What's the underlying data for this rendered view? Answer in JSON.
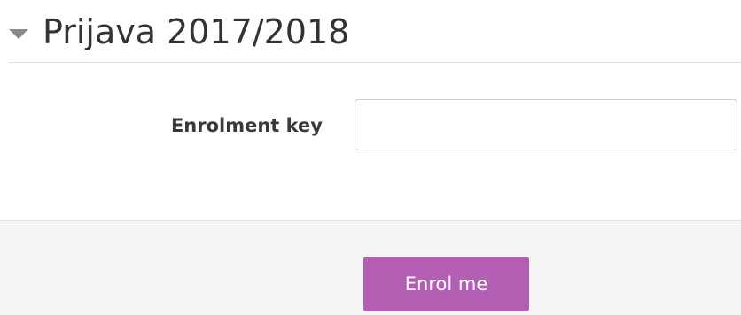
{
  "section": {
    "title": "Prijava 2017/2018",
    "collapse_icon": "caret-down-icon"
  },
  "form": {
    "enrolment_key_label": "Enrolment key",
    "enrolment_key_value": "",
    "enrolment_key_placeholder": ""
  },
  "actions": {
    "enrol_label": "Enrol me"
  },
  "colors": {
    "button_background": "#b25fb4",
    "footer_background": "#f5f5f5"
  }
}
